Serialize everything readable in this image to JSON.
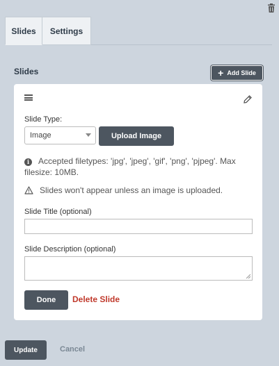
{
  "tabs": [
    {
      "label": "Slides",
      "active": true
    },
    {
      "label": "Settings",
      "active": false
    }
  ],
  "section": {
    "title": "Slides",
    "add_button_label": "Add Slide"
  },
  "slide": {
    "type_label": "Slide Type:",
    "type_value": "Image",
    "upload_button_label": "Upload Image",
    "info_text": "Accepted filetypes: 'jpg', 'jpeg', 'gif', 'png', 'pjpeg'. Max filesize: 10MB.",
    "warning_text": "Slides won't appear unless an image is uploaded.",
    "title_label": "Slide Title (optional)",
    "title_value": "",
    "description_label": "Slide Description (optional)",
    "description_value": "",
    "done_label": "Done",
    "delete_label": "Delete Slide"
  },
  "footer": {
    "update_label": "Update",
    "cancel_label": "Cancel"
  },
  "icons": {
    "trash": "trash-icon",
    "plus": "plus-icon",
    "drag": "hamburger-icon",
    "edit": "pencil-icon",
    "info": "info-icon",
    "warning": "warning-icon",
    "dropdown": "chevron-down-icon"
  },
  "colors": {
    "background": "#cdd5de",
    "button": "#4d5660",
    "danger": "#c0392b",
    "muted_link": "#7a8794"
  }
}
